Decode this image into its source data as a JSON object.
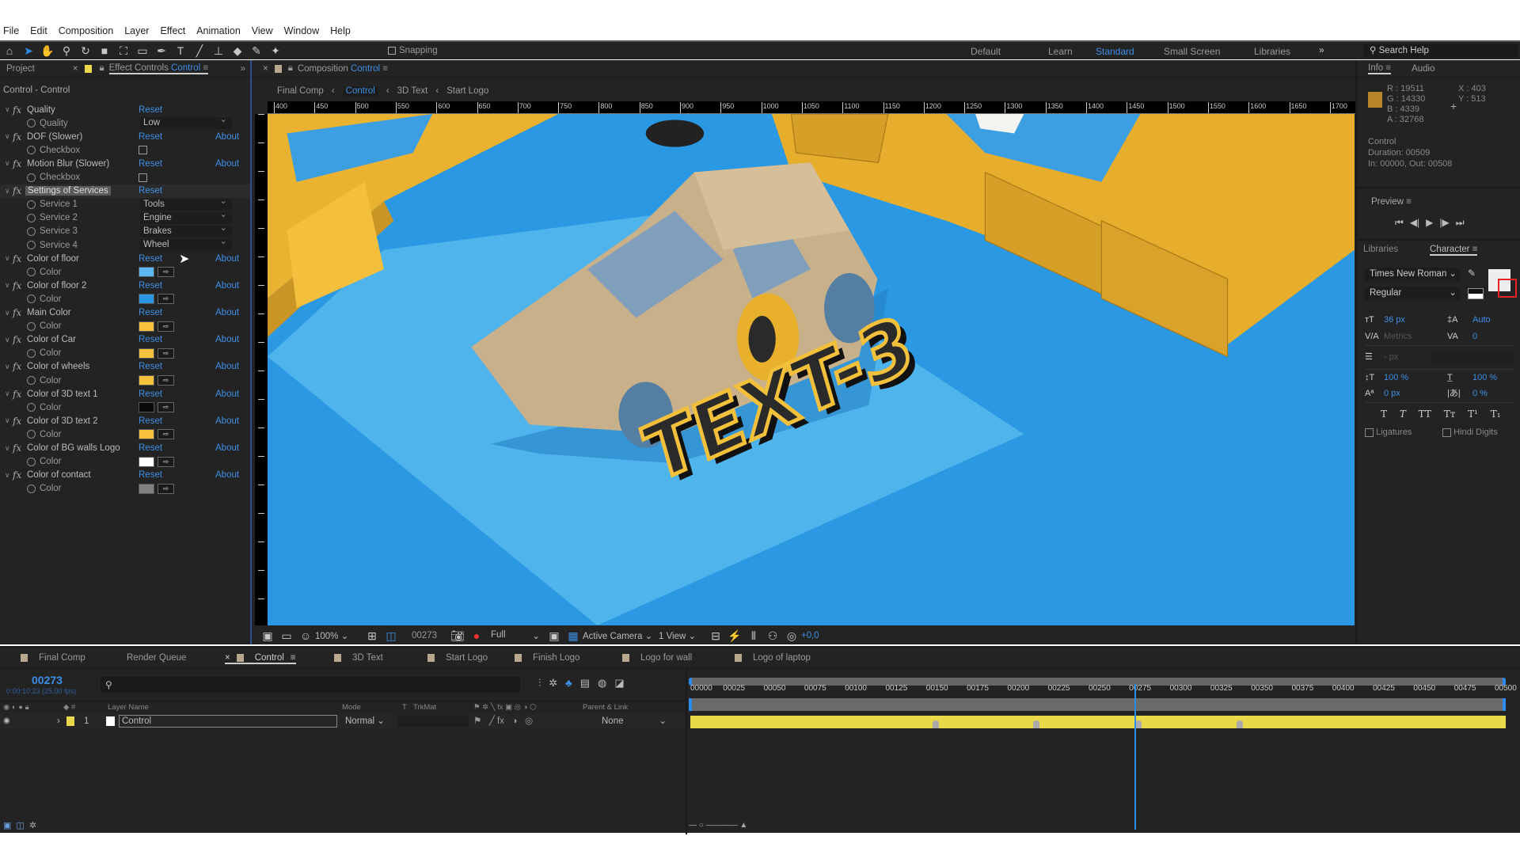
{
  "menu": [
    "File",
    "Edit",
    "Composition",
    "Layer",
    "Effect",
    "Animation",
    "View",
    "Window",
    "Help"
  ],
  "toolbar": {
    "snapping": "Snapping",
    "workspaces": [
      "Default",
      "Learn",
      "Standard",
      "Small Screen",
      "Libraries"
    ],
    "active_workspace": "Standard",
    "search_placeholder": "Search Help"
  },
  "left_panel": {
    "tab_project": "Project",
    "tab_effect": "Effect Controls",
    "tab_effect_layer": "Control",
    "title": "Control - Control",
    "reset": "Reset",
    "about": "About",
    "effects": [
      {
        "name": "Quality",
        "about": false,
        "props": [
          {
            "label": "Quality",
            "type": "dropdown",
            "value": "Low"
          }
        ]
      },
      {
        "name": "DOF (Slower)",
        "about": true,
        "props": [
          {
            "label": "Checkbox",
            "type": "checkbox",
            "value": false
          }
        ]
      },
      {
        "name": "Motion Blur (Slower)",
        "about": true,
        "props": [
          {
            "label": "Checkbox",
            "type": "checkbox",
            "value": false
          }
        ]
      },
      {
        "name": "Settings of Services",
        "about": false,
        "selected": true,
        "props": [
          {
            "label": "Service 1",
            "type": "dropdown",
            "value": "Tools"
          },
          {
            "label": "Service 2",
            "type": "dropdown",
            "value": "Engine"
          },
          {
            "label": "Service 3",
            "type": "dropdown",
            "value": "Brakes"
          },
          {
            "label": "Service 4",
            "type": "dropdown",
            "value": "Wheel"
          }
        ]
      },
      {
        "name": "Color of floor",
        "about": true,
        "props": [
          {
            "label": "Color",
            "type": "color",
            "value": "#5cb6f2"
          }
        ]
      },
      {
        "name": "Color of floor 2",
        "about": true,
        "props": [
          {
            "label": "Color",
            "type": "color",
            "value": "#2a96e2"
          }
        ]
      },
      {
        "name": "Main Color",
        "about": true,
        "props": [
          {
            "label": "Color",
            "type": "color",
            "value": "#f6c23e"
          }
        ]
      },
      {
        "name": "Color of Car",
        "about": true,
        "props": [
          {
            "label": "Color",
            "type": "color",
            "value": "#f6c23e"
          }
        ]
      },
      {
        "name": "Color of wheels",
        "about": true,
        "props": [
          {
            "label": "Color",
            "type": "color",
            "value": "#f6c23e"
          }
        ]
      },
      {
        "name": "Color of 3D text 1",
        "about": true,
        "props": [
          {
            "label": "Color",
            "type": "color",
            "value": "#0a0a0a"
          }
        ]
      },
      {
        "name": "Color of 3D text 2",
        "about": true,
        "props": [
          {
            "label": "Color",
            "type": "color",
            "value": "#f6c23e"
          }
        ]
      },
      {
        "name": "Color of BG walls Logo",
        "about": true,
        "props": [
          {
            "label": "Color",
            "type": "color",
            "value": "#ffffff"
          }
        ]
      },
      {
        "name": "Color of contact",
        "about": true,
        "props": [
          {
            "label": "Color",
            "type": "color",
            "value": "#808080"
          }
        ]
      }
    ]
  },
  "viewer": {
    "tab_label": "Composition",
    "tab_comp": "Control",
    "breadcrumbs": [
      "Final Comp",
      "Control",
      "3D Text",
      "Start Logo"
    ],
    "active_breadcrumb": "Control",
    "ruler": [
      "400",
      "450",
      "500",
      "550",
      "600",
      "650",
      "700",
      "750",
      "800",
      "850",
      "900",
      "950",
      "1000",
      "1050",
      "1100",
      "1150",
      "1200",
      "1250",
      "1300",
      "1350",
      "1400",
      "1450",
      "1500",
      "1550",
      "1600",
      "1650",
      "1700"
    ],
    "scene_text": "TEXT-3",
    "zoom": "100%",
    "frame": "00273",
    "resolution": "Full",
    "camera": "Active Camera",
    "views": "1 View",
    "exposure": "+0,0"
  },
  "info": {
    "tab_info": "Info",
    "tab_audio": "Audio",
    "swatch": "#b8862a",
    "r": "R : 19511",
    "g": "G : 14330",
    "b": "B : 4339",
    "a": "A : 32768",
    "x": "X : 403",
    "y": "Y : 513",
    "layer": "Control",
    "duration": "Duration: 00509",
    "inout": "In: 00000, Out: 00508"
  },
  "preview": {
    "title": "Preview"
  },
  "character": {
    "tab_libraries": "Libraries",
    "tab_character": "Character",
    "font": "Times New Roman",
    "style": "Regular",
    "size": "36 px",
    "leading": "Auto",
    "kerning": "Metrics",
    "tracking": "0",
    "stroke": "- px",
    "vscale": "100 %",
    "hscale": "100 %",
    "baseline": "0 px",
    "tsume": "0 %",
    "ligatures": "Ligatures",
    "hindi": "Hindi Digits"
  },
  "timeline": {
    "tabs": [
      "Final Comp",
      "Render Queue",
      "Control",
      "3D Text",
      "Start Logo",
      "Finish Logo",
      "Logo for wall",
      "Logo of laptop"
    ],
    "active_tab": "Control",
    "timecode": "00273",
    "timecode_sub": "0:00:10:23 (25.00 fps)",
    "columns": {
      "layer_name": "Layer Name",
      "mode": "Mode",
      "t": "T",
      "trkmat": "TrkMat",
      "parent": "Parent & Link"
    },
    "layer": {
      "index": "1",
      "name": "Control",
      "mode": "Normal",
      "parent": "None",
      "color": "#e8d84a"
    },
    "ticks": [
      "00000",
      "00025",
      "00050",
      "00075",
      "00100",
      "00125",
      "00150",
      "00175",
      "00200",
      "00225",
      "00250",
      "00275",
      "00300",
      "00325",
      "00350",
      "00375",
      "00400",
      "00425",
      "00450",
      "00475",
      "00500"
    ],
    "duration_frames": 500,
    "playhead_frame": 273,
    "keyframes": [
      150,
      212,
      275,
      337
    ]
  }
}
